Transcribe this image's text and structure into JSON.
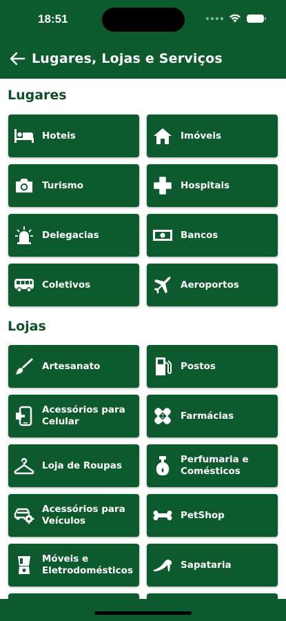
{
  "status": {
    "time": "18:51"
  },
  "header": {
    "title": "Lugares, Lojas e Serviços"
  },
  "sections": {
    "lugares": {
      "title": "Lugares",
      "items": [
        {
          "label": "Hoteis",
          "icon": "bed-icon"
        },
        {
          "label": "Imóveis",
          "icon": "house-icon"
        },
        {
          "label": "Turismo",
          "icon": "camera-icon"
        },
        {
          "label": "Hospitais",
          "icon": "medical-cross-icon"
        },
        {
          "label": "Delegacias",
          "icon": "siren-icon"
        },
        {
          "label": "Bancos",
          "icon": "banknote-icon"
        },
        {
          "label": "Coletivos",
          "icon": "bus-icon"
        },
        {
          "label": "Aeroportos",
          "icon": "airplane-icon"
        }
      ]
    },
    "lojas": {
      "title": "Lojas",
      "items": [
        {
          "label": "Artesanato",
          "icon": "paintbrush-icon"
        },
        {
          "label": "Postos",
          "icon": "gas-pump-icon"
        },
        {
          "label": "Acessórios para Celular",
          "icon": "phone-accessory-icon"
        },
        {
          "label": "Farmácias",
          "icon": "bandage-icon"
        },
        {
          "label": "Loja de Roupas",
          "icon": "hanger-icon"
        },
        {
          "label": "Perfumaria e Comésticos",
          "icon": "perfume-icon"
        },
        {
          "label": "Acessórios para Veículos",
          "icon": "car-gear-icon"
        },
        {
          "label": "PetShop",
          "icon": "bone-icon"
        },
        {
          "label": "Móveis e Eletrodomésticos",
          "icon": "blender-icon"
        },
        {
          "label": "Sapataria",
          "icon": "high-heel-icon"
        }
      ]
    }
  },
  "colors": {
    "primary": "#0e5a2f",
    "section_text": "#0e4f2a",
    "background": "#ffffff"
  }
}
